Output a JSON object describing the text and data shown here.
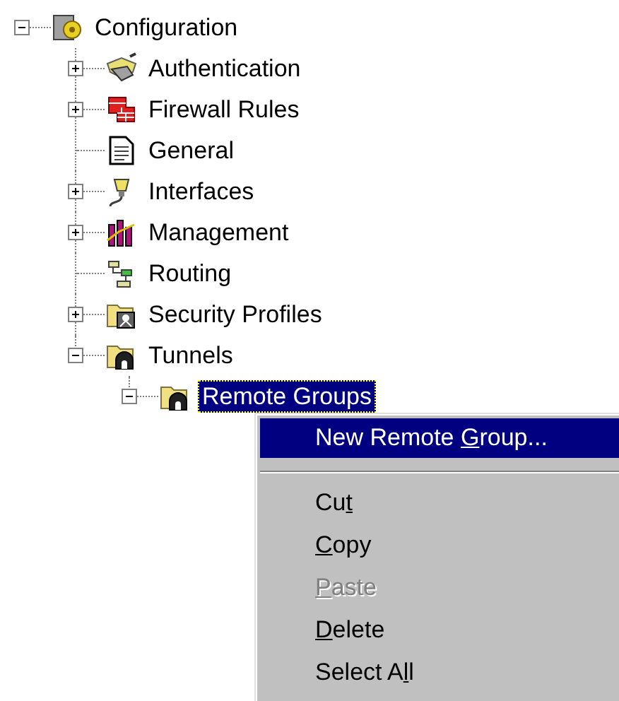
{
  "tree": [
    {
      "label": "Configuration",
      "expanded": true,
      "selected": false,
      "children": [
        {
          "label": "Authentication",
          "expanded": false,
          "selected": false
        },
        {
          "label": "Firewall Rules",
          "expanded": false,
          "selected": false
        },
        {
          "label": "General",
          "selected": false
        },
        {
          "label": "Interfaces",
          "expanded": false,
          "selected": false
        },
        {
          "label": "Management",
          "expanded": false,
          "selected": false
        },
        {
          "label": "Routing",
          "selected": false
        },
        {
          "label": "Security Profiles",
          "expanded": false,
          "selected": false
        },
        {
          "label": "Tunnels",
          "expanded": true,
          "selected": false,
          "children": [
            {
              "label": "Remote Groups",
              "expanded": true,
              "selected": true
            }
          ]
        }
      ]
    }
  ],
  "context_menu": {
    "items": [
      {
        "kind": "command",
        "before": "New Remote ",
        "key": "G",
        "after": "roup...",
        "selected": true,
        "disabled": false
      },
      {
        "kind": "separator"
      },
      {
        "kind": "command",
        "before": "Cu",
        "key": "t",
        "selected": false,
        "disabled": false
      },
      {
        "kind": "command",
        "key": "C",
        "after": "opy",
        "selected": false,
        "disabled": false
      },
      {
        "kind": "command",
        "key": "P",
        "after": "aste",
        "selected": false,
        "disabled": true
      },
      {
        "kind": "command",
        "key": "D",
        "after": "elete",
        "selected": false,
        "disabled": false
      },
      {
        "kind": "command",
        "before": "Select A",
        "key": "l",
        "after": "l",
        "selected": false,
        "disabled": false
      }
    ]
  }
}
